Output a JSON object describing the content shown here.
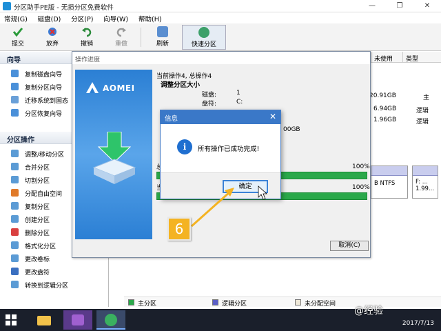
{
  "window": {
    "title": "分区助手PE版 - 无损分区免费软件",
    "min": "—",
    "max": "❐",
    "close": "✕"
  },
  "menu": [
    "常规(G)",
    "磁盘(D)",
    "分区(P)",
    "向导(W)",
    "帮助(H)"
  ],
  "toolbar": {
    "commit": "提交",
    "discard": "放弃",
    "undo": "撤销",
    "redo": "重做",
    "refresh": "刷新",
    "quick_partition": "快速分区"
  },
  "wizard": {
    "heading": "向导",
    "items": [
      "复制磁盘向导",
      "复制分区向导",
      "迁移系统到固态",
      "分区恢复向导"
    ]
  },
  "ops": {
    "heading": "分区操作",
    "items": [
      "调整/移动分区",
      "合并分区",
      "切割分区",
      "分配自由空间",
      "复制分区",
      "创建分区",
      "删除分区",
      "格式化分区",
      "更改卷标",
      "更改盘符",
      "转换到逻辑分区"
    ]
  },
  "table": {
    "col_unused": "未使用",
    "col_type": "类型",
    "rows": [
      {
        "unused": "20.91GB",
        "type": "主"
      },
      {
        "unused": "6.94GB",
        "type": "逻辑"
      },
      {
        "unused": "1.96GB",
        "type": "逻辑"
      }
    ]
  },
  "diskmap": {
    "card1": "B NTFS",
    "card2_top": "F: ...",
    "card2_bottom": "1.99..."
  },
  "legend": {
    "primary": "主分区",
    "logical": "逻辑分区",
    "unallocated": "未分配空间"
  },
  "progress": {
    "title": "操作进度",
    "brand": "AOMEI",
    "current": "当前操作4, 总操作4",
    "operation": "调整分区大小",
    "disk_label": "磁盘:",
    "disk_value": "1",
    "drive_label": "盘符:",
    "drive_value": "C:",
    "size_fragment": "00GB",
    "total_frag": "总",
    "current_frag": "当",
    "pct1": "100%",
    "pct2": "100%",
    "cancel": "取消(C)"
  },
  "info": {
    "title": "信息",
    "close": "✕",
    "icon": "i",
    "message": "所有操作已成功完成!",
    "ok": "确定"
  },
  "annotation": {
    "step": "6"
  },
  "taskbar": {
    "date": "2017/7/13"
  },
  "watermark": "@经验"
}
